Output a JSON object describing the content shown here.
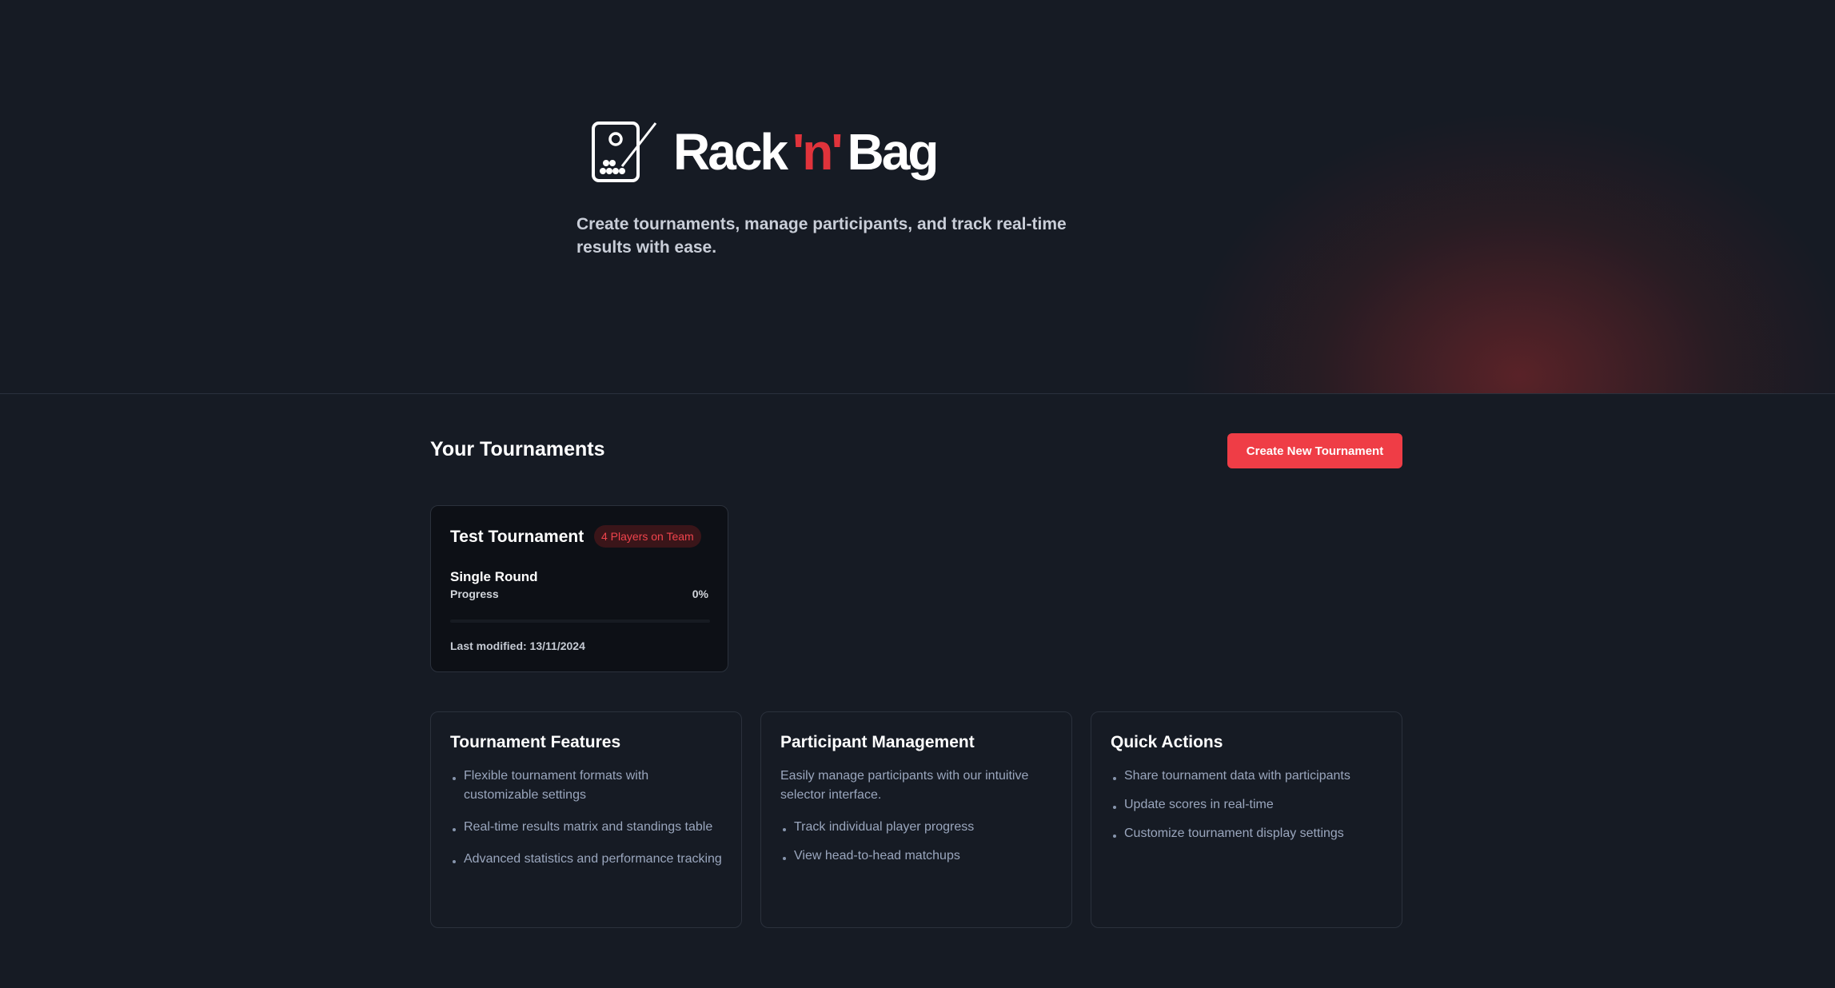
{
  "brand": {
    "part1": "Rack",
    "part2": "'n'",
    "part3": "Bag",
    "accent_color": "#e0333b",
    "logo_icon": "scoreboard-cue-icon"
  },
  "hero": {
    "tagline": "Create tournaments, manage participants, and track real-time results with ease."
  },
  "tournaments": {
    "section_title": "Your Tournaments",
    "create_button": "Create New Tournament",
    "items": [
      {
        "name": "Test Tournament",
        "badge": "4 Players on Team",
        "round": "Single Round",
        "progress_label": "Progress",
        "progress_value": "0%",
        "progress_fraction": 0,
        "last_modified": "Last modified: 13/11/2024"
      }
    ]
  },
  "features": [
    {
      "title": "Tournament Features",
      "items": [
        "Flexible tournament formats with customizable settings",
        "Real-time results matrix and standings table",
        "Advanced statistics and performance tracking"
      ]
    },
    {
      "title": "Participant Management",
      "description": "Easily manage participants with our intuitive selector interface.",
      "items": [
        "Track individual player progress",
        "View head-to-head matchups"
      ]
    },
    {
      "title": "Quick Actions",
      "items": [
        "Share tournament data with participants",
        "Update scores in real-time",
        "Customize tournament display settings"
      ]
    }
  ]
}
